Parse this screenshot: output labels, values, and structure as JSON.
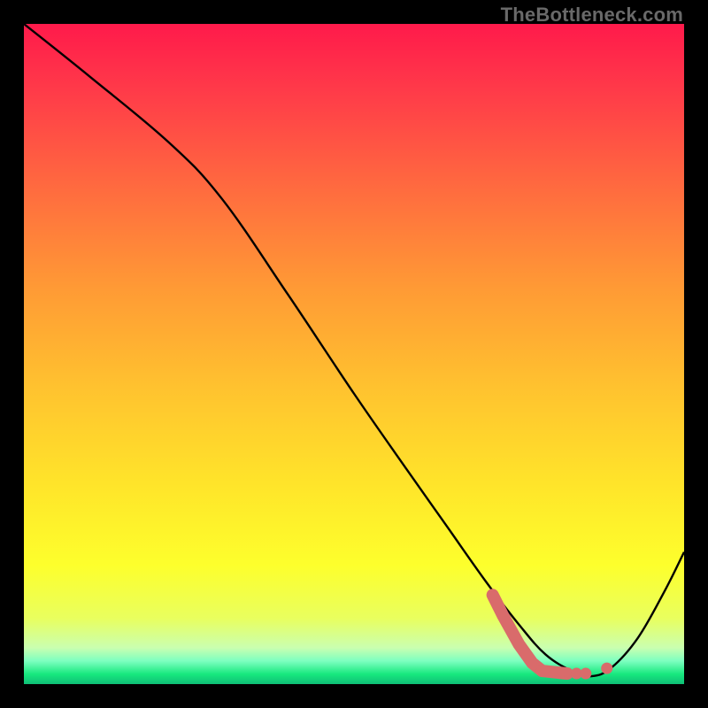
{
  "watermark": "TheBottleneck.com",
  "colors": {
    "frame": "#000000",
    "curve": "#000000",
    "marker_fill": "#d96b6b",
    "gradient_stops": [
      {
        "offset": 0.0,
        "color": "#ff1a4b"
      },
      {
        "offset": 0.1,
        "color": "#ff3a49"
      },
      {
        "offset": 0.25,
        "color": "#ff6b3f"
      },
      {
        "offset": 0.4,
        "color": "#ff9a35"
      },
      {
        "offset": 0.55,
        "color": "#ffc22f"
      },
      {
        "offset": 0.7,
        "color": "#ffe52a"
      },
      {
        "offset": 0.82,
        "color": "#fdff2c"
      },
      {
        "offset": 0.9,
        "color": "#e9ff5e"
      },
      {
        "offset": 0.945,
        "color": "#caffb0"
      },
      {
        "offset": 0.965,
        "color": "#7dffc0"
      },
      {
        "offset": 0.985,
        "color": "#17e87e"
      },
      {
        "offset": 1.0,
        "color": "#0fbf76"
      }
    ]
  },
  "chart_data": {
    "type": "line",
    "title": "",
    "xlabel": "",
    "ylabel": "",
    "xlim": [
      0,
      100
    ],
    "ylim": [
      0,
      100
    ],
    "grid": false,
    "series": [
      {
        "name": "bottleneck-curve",
        "x": [
          0,
          10,
          22,
          30,
          40,
          50,
          58,
          64,
          70,
          75,
          79,
          83,
          86,
          89,
          93,
          97,
          100
        ],
        "y": [
          100,
          92,
          82,
          73.5,
          59,
          44,
          32.5,
          24,
          15.5,
          9,
          4.5,
          2,
          1.2,
          2.5,
          7,
          14,
          20
        ]
      }
    ],
    "highlight_segments": [
      {
        "name": "thick-drop",
        "x": [
          71,
          72.5,
          75,
          77,
          78.5
        ],
        "y": [
          13.5,
          10.5,
          6,
          3.2,
          2.0
        ]
      },
      {
        "name": "thick-flat",
        "x": [
          78.5,
          82.3
        ],
        "y": [
          2.0,
          1.6
        ]
      }
    ],
    "highlight_points": [
      {
        "x": 83.7,
        "y": 1.6
      },
      {
        "x": 85.1,
        "y": 1.6
      },
      {
        "x": 88.3,
        "y": 2.4
      }
    ]
  }
}
